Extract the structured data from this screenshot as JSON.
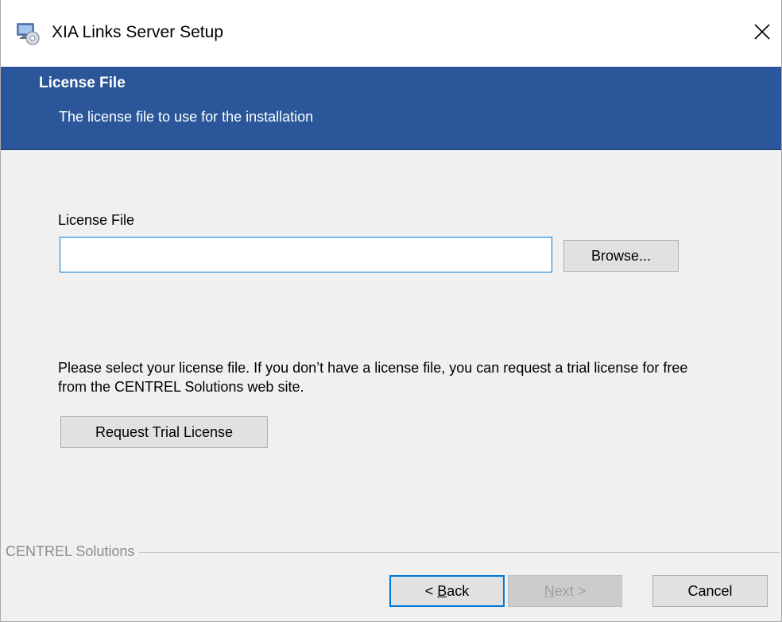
{
  "window": {
    "title": "XIA Links Server Setup"
  },
  "banner": {
    "title": "License File",
    "subtitle": "The license file to use for the installation",
    "color": "#2b579a"
  },
  "form": {
    "license_label": "License File",
    "license_value": "",
    "browse_label": "Browse...",
    "help_text": "Please select your license file. If you don’t have a license file, you can request a trial license for free from the CENTREL Solutions web site.",
    "trial_button_label": "Request Trial License"
  },
  "footer": {
    "group_label": "CENTREL Solutions",
    "back_label_rest": "ack",
    "back_label_underlined": "B",
    "back_label_prefix": "< ",
    "next_label_underlined": "N",
    "next_label_rest": "ext >",
    "cancel_label": "Cancel"
  },
  "icons": {
    "app": "setup-computer-icon",
    "close": "close-icon"
  }
}
